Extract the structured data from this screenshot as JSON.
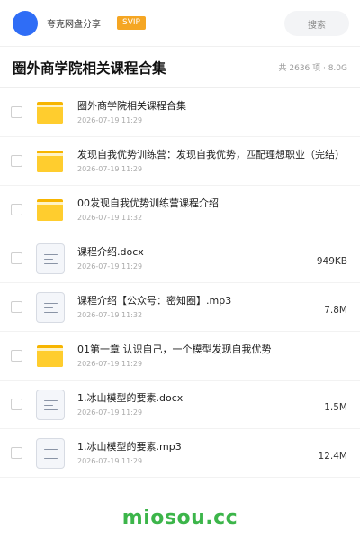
{
  "header": {
    "share_label": "夸克网盘分享",
    "badge": "SVIP",
    "search_label": "搜索"
  },
  "title": {
    "text": "圈外商学院相关课程合集",
    "meta": "共 2636 项 · 8.0G"
  },
  "files": [
    {
      "type": "folder",
      "name": "圈外商学院相关课程合集",
      "date": "2026-07-19 11:29",
      "size": ""
    },
    {
      "type": "folder",
      "name": "发现自我优势训练营：发现自我优势，匹配理想职业（完结）",
      "date": "2026-07-19 11:29",
      "size": ""
    },
    {
      "type": "folder",
      "name": "00发现自我优势训练营课程介绍",
      "date": "2026-07-19 11:32",
      "size": ""
    },
    {
      "type": "doc",
      "name": "课程介绍.docx",
      "date": "2026-07-19 11:29",
      "size": "949KB"
    },
    {
      "type": "doc",
      "name": "课程介绍【公众号：密知圈】.mp3",
      "date": "2026-07-19 11:32",
      "size": "7.8M"
    },
    {
      "type": "folder",
      "name": "01第一章 认识自己，一个模型发现自我优势",
      "date": "2026-07-19 11:29",
      "size": ""
    },
    {
      "type": "doc",
      "name": "1.冰山模型的要素.docx",
      "date": "2026-07-19 11:29",
      "size": "1.5M"
    },
    {
      "type": "doc",
      "name": "1.冰山模型的要素.mp3",
      "date": "2026-07-19 11:29",
      "size": "12.4M"
    }
  ],
  "watermark": "miosou.cc"
}
